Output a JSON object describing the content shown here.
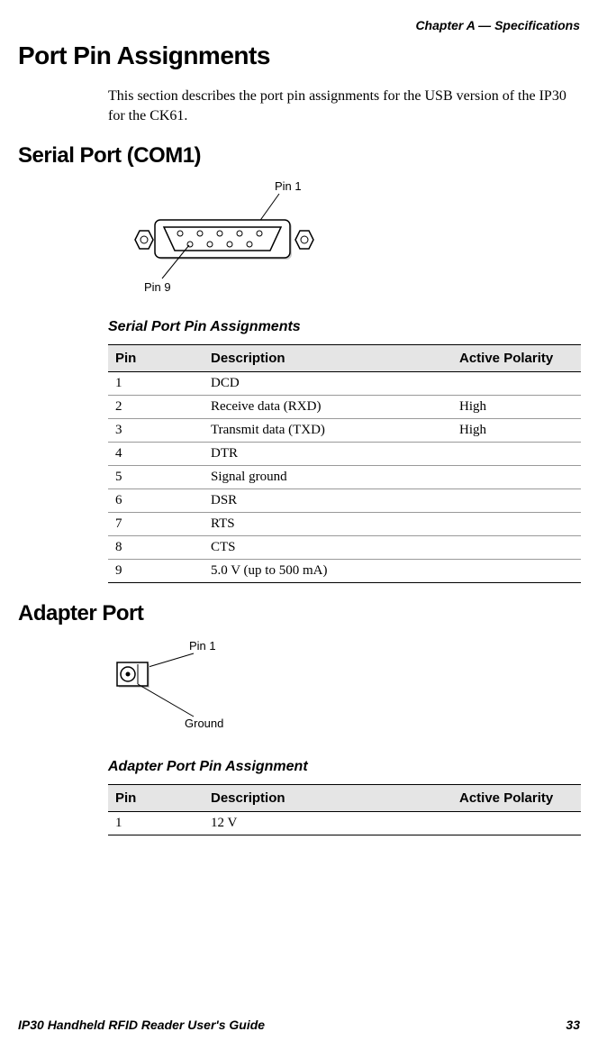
{
  "chapter_header": "Chapter A — Specifications",
  "h1": "Port Pin Assignments",
  "intro": "This section describes the port pin assignments for the USB version of the IP30 for the CK61.",
  "serial": {
    "heading": "Serial Port (COM1)",
    "diagram": {
      "pin1": "Pin 1",
      "pin9": "Pin 9"
    },
    "table_title": "Serial Port Pin Assignments",
    "columns": {
      "pin": "Pin",
      "desc": "Description",
      "pol": "Active Polarity"
    },
    "rows": [
      {
        "pin": "1",
        "desc": "DCD",
        "pol": ""
      },
      {
        "pin": "2",
        "desc": "Receive data (RXD)",
        "pol": "High"
      },
      {
        "pin": "3",
        "desc": "Transmit data (TXD)",
        "pol": "High"
      },
      {
        "pin": "4",
        "desc": "DTR",
        "pol": ""
      },
      {
        "pin": "5",
        "desc": "Signal ground",
        "pol": ""
      },
      {
        "pin": "6",
        "desc": "DSR",
        "pol": ""
      },
      {
        "pin": "7",
        "desc": "RTS",
        "pol": ""
      },
      {
        "pin": "8",
        "desc": "CTS",
        "pol": ""
      },
      {
        "pin": "9",
        "desc": "5.0 V (up to 500 mA)",
        "pol": ""
      }
    ]
  },
  "adapter": {
    "heading": "Adapter Port",
    "diagram": {
      "pin1": "Pin 1",
      "ground": "Ground"
    },
    "table_title": "Adapter Port Pin Assignment",
    "columns": {
      "pin": "Pin",
      "desc": "Description",
      "pol": "Active Polarity"
    },
    "rows": [
      {
        "pin": "1",
        "desc": "12 V",
        "pol": ""
      }
    ]
  },
  "footer": {
    "left": "IP30 Handheld RFID Reader User's Guide",
    "right": "33"
  }
}
